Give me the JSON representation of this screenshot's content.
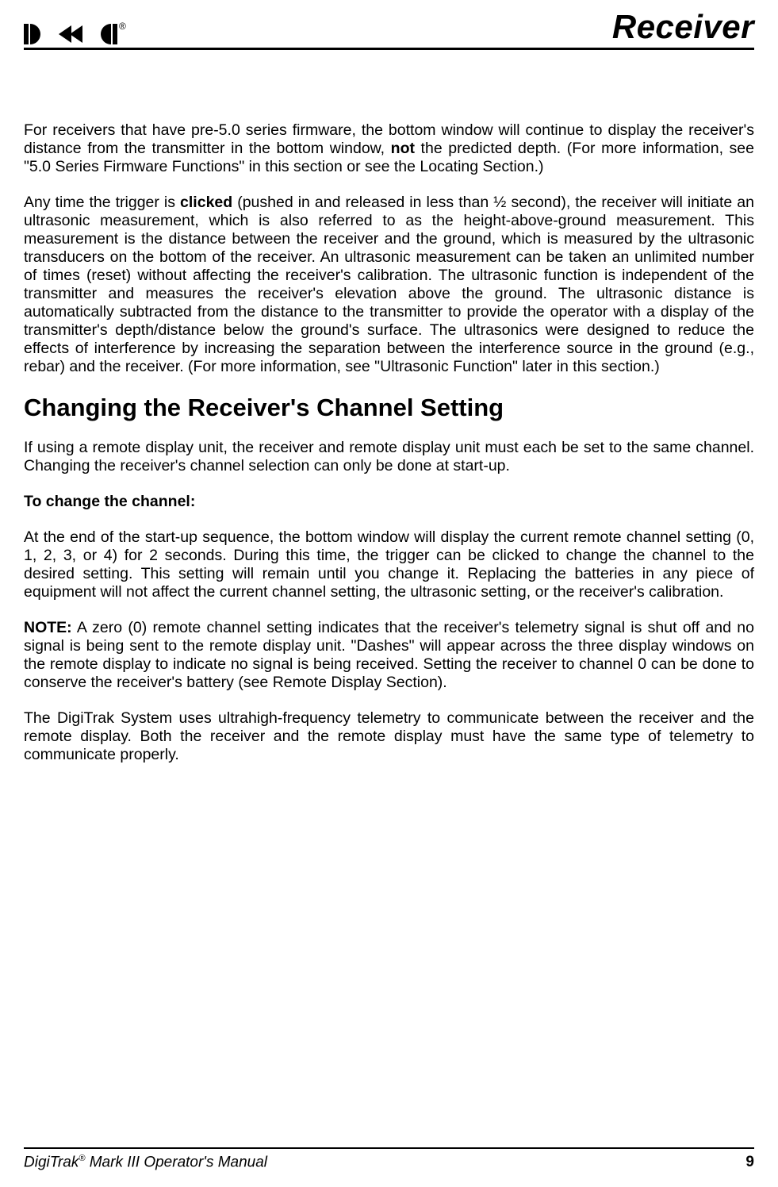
{
  "header": {
    "logo_reg": "®",
    "title": "Receiver"
  },
  "paragraphs": {
    "p1a": "For receivers that have pre-5.0 series firmware, the bottom window will continue to display the receiver's distance from the transmitter in the bottom window, ",
    "p1b_bold": "not",
    "p1c": " the predicted depth.  (For more information, see \"5.0 Series Firmware Functions\" in this section or see the Locating Section.)",
    "p2a": "Any time the trigger is ",
    "p2b_bold": "clicked",
    "p2c": " (pushed in and released in less than ½ second), the receiver will initiate an ultrasonic measurement, which is also referred to as the height-above-ground measurement.  This measurement is the distance between the receiver and the ground, which is measured by the ultrasonic transducers on the bottom of the receiver.  An ultrasonic measurement can be taken an unlimited number of times (reset) without affecting the receiver's calibration.  The ultrasonic function is independent of the transmitter and measures the receiver's elevation above the ground.  The ultrasonic distance is automatically subtracted from the distance to the transmitter to provide the operator with a display of the transmitter's depth/distance below the ground's surface.  The ultrasonics were designed to reduce the effects of interference by increasing the separation between the interference source in the ground (e.g., rebar) and the receiver.  (For more information, see \"Ultrasonic Function\" later in this section.)",
    "h2": "Changing the Receiver's Channel Setting",
    "p3": "If using a remote display unit, the receiver and remote display unit must each be set to the same channel.  Changing the receiver's channel selection can only be done at start-up.",
    "sub1": "To change the channel:",
    "p4": "At the end of the start-up sequence, the bottom window will display the current remote channel setting (0, 1, 2, 3, or 4) for 2 seconds.  During this time, the trigger can be clicked to change the channel to the desired setting.  This setting will remain until you change it.  Replacing the batteries in any piece of equipment will not affect the current channel setting, the ultrasonic setting, or the receiver's calibration.",
    "p5a_bold": "NOTE:",
    "p5b": "  A zero (0) remote channel setting indicates that the receiver's telemetry signal is shut off and no signal is being sent to the remote display unit.  \"Dashes\" will appear across the three display windows on the remote display to indicate no signal is being received.  Setting the receiver to channel 0 can be done to conserve the receiver's battery (see Remote Display Section).",
    "p6": "The DigiTrak System uses ultrahigh-frequency telemetry to communicate between the receiver and the remote display.  Both the receiver and the remote display must have the same type of telemetry to communicate properly."
  },
  "footer": {
    "left_a": "DigiTrak",
    "left_sup": "®",
    "left_b": " Mark III Operator's Manual",
    "page_number": "9"
  }
}
